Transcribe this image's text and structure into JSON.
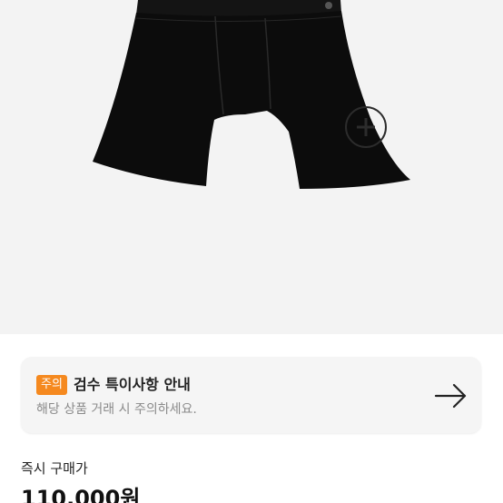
{
  "notice": {
    "badge": "주의",
    "title": "검수 특이사항 안내",
    "description": "해당 상품 거래 시 주의하세요.",
    "icon": "arrow-right-icon",
    "badge_color": "#f5891f"
  },
  "price": {
    "label": "즉시 구매가",
    "value": "110,000원"
  },
  "product_image": {
    "icon": "boxer-briefs-image"
  }
}
